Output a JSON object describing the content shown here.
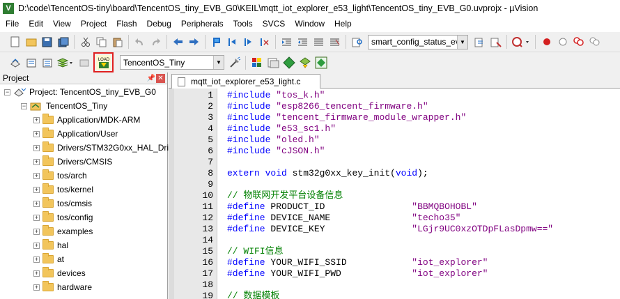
{
  "window": {
    "title": "D:\\code\\TencentOS-tiny\\board\\TencentOS_tiny_EVB_G0\\KEIL\\mqtt_iot_explorer_e53_light\\TencentOS_tiny_EVB_G0.uvprojx - µVision"
  },
  "menu": [
    "File",
    "Edit",
    "View",
    "Project",
    "Flash",
    "Debug",
    "Peripherals",
    "Tools",
    "SVCS",
    "Window",
    "Help"
  ],
  "toolbar1": {
    "find_combo": "smart_config_status_even"
  },
  "toolbar2": {
    "target_combo": "TencentOS_Tiny",
    "load_label": "LOAD"
  },
  "project_panel": {
    "title": "Project",
    "root": "Project: TencentOS_tiny_EVB_G0",
    "target": "TencentOS_Tiny",
    "groups": [
      "Application/MDK-ARM",
      "Application/User",
      "Drivers/STM32G0xx_HAL_Dri",
      "Drivers/CMSIS",
      "tos/arch",
      "tos/kernel",
      "tos/cmsis",
      "tos/config",
      "examples",
      "hal",
      "at",
      "devices",
      "hardware"
    ]
  },
  "editor": {
    "tab": "mqtt_iot_explorer_e53_light.c",
    "lines": [
      {
        "n": "1",
        "parts": [
          [
            "pp",
            "#include "
          ],
          [
            "str",
            "\"tos_k.h\""
          ]
        ]
      },
      {
        "n": "2",
        "parts": [
          [
            "pp",
            "#include "
          ],
          [
            "str",
            "\"esp8266_tencent_firmware.h\""
          ]
        ]
      },
      {
        "n": "3",
        "parts": [
          [
            "pp",
            "#include "
          ],
          [
            "str",
            "\"tencent_firmware_module_wrapper.h\""
          ]
        ]
      },
      {
        "n": "4",
        "parts": [
          [
            "pp",
            "#include "
          ],
          [
            "str",
            "\"e53_sc1.h\""
          ]
        ]
      },
      {
        "n": "5",
        "parts": [
          [
            "pp",
            "#include "
          ],
          [
            "str",
            "\"oled.h\""
          ]
        ]
      },
      {
        "n": "6",
        "parts": [
          [
            "pp",
            "#include "
          ],
          [
            "str",
            "\"cJSON.h\""
          ]
        ]
      },
      {
        "n": "7",
        "parts": []
      },
      {
        "n": "8",
        "parts": [
          [
            "kw",
            "extern void "
          ],
          [
            "plain",
            "stm32g0xx_key_init("
          ],
          [
            "kw",
            "void"
          ],
          [
            "plain",
            ");"
          ]
        ]
      },
      {
        "n": "9",
        "parts": []
      },
      {
        "n": "10",
        "parts": [
          [
            "cm",
            "// 物联网开发平台设备信息"
          ]
        ]
      },
      {
        "n": "11",
        "parts": [
          [
            "pp",
            "#define "
          ],
          [
            "plain",
            "PRODUCT_ID                "
          ],
          [
            "str",
            "\"BBMQBOHOBL\""
          ]
        ]
      },
      {
        "n": "12",
        "parts": [
          [
            "pp",
            "#define "
          ],
          [
            "plain",
            "DEVICE_NAME               "
          ],
          [
            "str",
            "\"techo35\""
          ]
        ]
      },
      {
        "n": "13",
        "parts": [
          [
            "pp",
            "#define "
          ],
          [
            "plain",
            "DEVICE_KEY                "
          ],
          [
            "str",
            "\"LGjr9UC0xzOTDpFLasDpmw==\""
          ]
        ]
      },
      {
        "n": "14",
        "parts": []
      },
      {
        "n": "15",
        "parts": [
          [
            "cm",
            "// WIFI信息"
          ]
        ]
      },
      {
        "n": "16",
        "parts": [
          [
            "pp",
            "#define "
          ],
          [
            "plain",
            "YOUR_WIFI_SSID            "
          ],
          [
            "str",
            "\"iot_explorer\""
          ]
        ]
      },
      {
        "n": "17",
        "parts": [
          [
            "pp",
            "#define "
          ],
          [
            "plain",
            "YOUR_WIFI_PWD             "
          ],
          [
            "str",
            "\"iot_explorer\""
          ]
        ]
      },
      {
        "n": "18",
        "parts": []
      },
      {
        "n": "19",
        "parts": [
          [
            "cm",
            "// 数据模板"
          ]
        ]
      }
    ]
  },
  "colors": {
    "keyword": "#0000ff",
    "string": "#800080",
    "comment": "#008000",
    "highlight": "#e02020"
  }
}
